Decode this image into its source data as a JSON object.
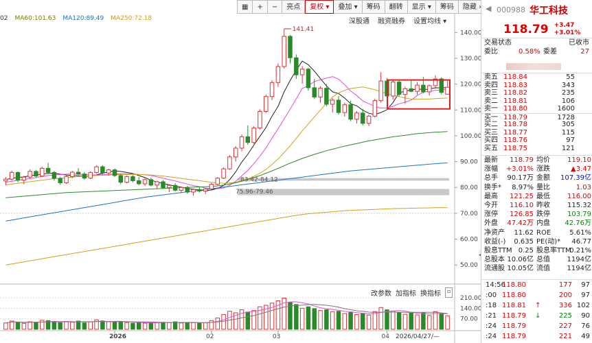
{
  "toolbar": {
    "icons": [
      "calendar-icon",
      "plus-icon",
      "minus-icon"
    ],
    "buttons": [
      "叠加",
      "筹码",
      "翻转",
      "显示",
      "筹码",
      "隐藏"
    ],
    "buttons_full": [
      "复权",
      "叠加",
      "筹码",
      "翻转",
      "显示",
      "筹码",
      "隐藏"
    ],
    "items": [
      "亮点",
      "复权",
      "叠加",
      "筹码",
      "翻转",
      "显示",
      "筹码",
      "隐藏"
    ],
    "active": "复权",
    "more": "»"
  },
  "subtoolbar": {
    "items": [
      "深股通",
      "融资融券",
      "设置均线"
    ]
  },
  "ma_legend": [
    {
      "label": "02",
      "color": "#333333"
    },
    {
      "label": "MA60:101.63",
      "color": "#7a7a00"
    },
    {
      "label": "MA120:89.49",
      "color": "#1a73c8"
    },
    {
      "label": "MA250:72.18",
      "color": "#d4a017"
    }
  ],
  "chart_annotations": {
    "high": "141.41",
    "label_a": "83.42-84.12",
    "label_b": "75.96-79.46"
  },
  "price_axis": [
    "140.00",
    "130.00",
    "120.00",
    "110.00",
    "100.00",
    "90.00",
    "80.00",
    "70.00",
    "60.00",
    "50.00"
  ],
  "volume_axis": [
    "210.00",
    "140.00",
    "70.00"
  ],
  "x_axis": [
    "2026",
    "02",
    "03",
    "04"
  ],
  "cursor_date": "2026/04/27/—",
  "indicator_toolbar": [
    "改参数",
    "加指标",
    "换指标"
  ],
  "chart_data": {
    "type": "candlestick",
    "price_range": [
      45,
      143
    ],
    "volume_range": [
      0,
      215
    ],
    "candles": [
      [
        82.5,
        84.0,
        80.8,
        83.2,
        42
      ],
      [
        83.2,
        86.5,
        82.6,
        85.8,
        55
      ],
      [
        85.8,
        86.2,
        82.0,
        82.8,
        48
      ],
      [
        82.8,
        84.5,
        81.2,
        84.0,
        40
      ],
      [
        84.0,
        87.0,
        83.5,
        86.2,
        50
      ],
      [
        86.2,
        86.8,
        83.8,
        84.4,
        45
      ],
      [
        84.4,
        88.0,
        84.0,
        87.4,
        60
      ],
      [
        87.4,
        89.5,
        85.2,
        85.8,
        58
      ],
      [
        85.8,
        86.4,
        82.6,
        83.5,
        50
      ],
      [
        83.5,
        84.2,
        81.0,
        81.8,
        44
      ],
      [
        81.8,
        84.8,
        81.4,
        84.2,
        52
      ],
      [
        84.2,
        86.4,
        83.6,
        85.9,
        47
      ],
      [
        85.9,
        87.5,
        84.8,
        85.2,
        55
      ],
      [
        85.2,
        86.0,
        83.0,
        83.6,
        42
      ],
      [
        83.6,
        86.2,
        83.2,
        85.8,
        49
      ],
      [
        85.8,
        88.5,
        85.4,
        88.0,
        63
      ],
      [
        88.0,
        88.6,
        85.0,
        85.6,
        56
      ],
      [
        85.6,
        87.2,
        84.6,
        86.8,
        50
      ],
      [
        86.8,
        87.4,
        84.0,
        84.6,
        48
      ],
      [
        84.6,
        85.2,
        81.2,
        82.0,
        52
      ],
      [
        82.0,
        84.6,
        81.6,
        84.2,
        45
      ],
      [
        84.2,
        84.8,
        82.0,
        82.6,
        40
      ],
      [
        82.6,
        84.0,
        80.8,
        81.4,
        44
      ],
      [
        81.4,
        83.5,
        80.6,
        83.0,
        41
      ],
      [
        83.0,
        83.8,
        80.4,
        80.9,
        46
      ],
      [
        80.9,
        82.6,
        79.6,
        82.2,
        43
      ],
      [
        82.2,
        82.8,
        79.4,
        79.9,
        47
      ],
      [
        79.9,
        81.2,
        78.2,
        80.8,
        45
      ],
      [
        80.8,
        81.6,
        78.4,
        78.9,
        50
      ],
      [
        78.9,
        80.4,
        77.8,
        80.0,
        42
      ],
      [
        80.0,
        80.6,
        77.6,
        78.2,
        46
      ],
      [
        78.2,
        79.6,
        76.8,
        79.2,
        44
      ],
      [
        79.2,
        80.2,
        78.0,
        78.6,
        40
      ],
      [
        78.6,
        79.8,
        77.4,
        79.4,
        43
      ],
      [
        79.4,
        81.8,
        79.0,
        81.2,
        58
      ],
      [
        81.2,
        84.0,
        80.8,
        83.6,
        75
      ],
      [
        83.6,
        87.8,
        83.2,
        87.2,
        98
      ],
      [
        87.2,
        92.5,
        86.8,
        91.8,
        120
      ],
      [
        91.8,
        96.0,
        90.0,
        95.2,
        110
      ],
      [
        95.2,
        100.5,
        94.0,
        99.6,
        130
      ],
      [
        99.6,
        104.0,
        96.5,
        97.4,
        115
      ],
      [
        97.4,
        103.8,
        96.8,
        103.0,
        125
      ],
      [
        103.0,
        110.2,
        102.4,
        109.4,
        150
      ],
      [
        109.4,
        116.0,
        108.8,
        115.2,
        160
      ],
      [
        115.2,
        121.5,
        113.8,
        120.6,
        175
      ],
      [
        120.6,
        128.0,
        119.0,
        126.8,
        190
      ],
      [
        126.8,
        141.41,
        126.0,
        138.5,
        208
      ],
      [
        138.5,
        139.0,
        128.0,
        130.2,
        180
      ],
      [
        130.2,
        131.5,
        122.0,
        123.6,
        165
      ],
      [
        123.6,
        127.0,
        120.2,
        125.8,
        140
      ],
      [
        125.8,
        126.4,
        117.5,
        118.6,
        150
      ],
      [
        118.6,
        122.0,
        114.2,
        115.0,
        138
      ],
      [
        115.0,
        119.2,
        112.8,
        118.4,
        125
      ],
      [
        118.4,
        120.0,
        111.4,
        112.2,
        130
      ],
      [
        112.2,
        114.6,
        109.0,
        113.8,
        118
      ],
      [
        113.8,
        115.4,
        108.2,
        109.0,
        120
      ],
      [
        109.0,
        112.8,
        107.4,
        112.0,
        105
      ],
      [
        112.0,
        113.6,
        105.6,
        106.4,
        112
      ],
      [
        106.4,
        109.6,
        104.8,
        108.8,
        98
      ],
      [
        108.8,
        110.4,
        104.0,
        104.8,
        104
      ],
      [
        104.8,
        108.2,
        103.8,
        107.6,
        95
      ],
      [
        107.6,
        114.4,
        107.0,
        113.6,
        118
      ],
      [
        113.6,
        124.6,
        112.8,
        121.2,
        145
      ],
      [
        121.2,
        122.4,
        114.6,
        115.4,
        130
      ],
      [
        115.4,
        121.6,
        114.0,
        120.8,
        122
      ],
      [
        120.8,
        121.8,
        115.2,
        116.0,
        110
      ],
      [
        116.0,
        119.0,
        112.4,
        118.2,
        100
      ],
      [
        118.2,
        121.4,
        116.8,
        117.2,
        108
      ],
      [
        117.2,
        120.8,
        115.8,
        119.6,
        96
      ],
      [
        119.6,
        122.8,
        116.4,
        117.0,
        112
      ],
      [
        117.0,
        119.8,
        115.6,
        119.4,
        92
      ],
      [
        119.4,
        123.4,
        118.2,
        122.0,
        118
      ],
      [
        122.0,
        122.6,
        116.0,
        116.8,
        105
      ],
      [
        116.1,
        121.25,
        116.0,
        118.79,
        90
      ]
    ],
    "ma": {
      "ma5": [
        83,
        83.6,
        83.8,
        84.1,
        84.5,
        84.8,
        85.2,
        85.4,
        85.5,
        85.1,
        84.8,
        84.6,
        84.5,
        84.4,
        84.3,
        84.9,
        85.5,
        86.0,
        86.4,
        86.2,
        85.8,
        85.4,
        84.6,
        83.8,
        82.8,
        82.1,
        81.5,
        81.0,
        80.5,
        80.1,
        79.6,
        79.3,
        79.0,
        78.8,
        79.0,
        79.6,
        80.8,
        83.0,
        86.0,
        89.8,
        92.8,
        96.4,
        99.8,
        103.2,
        107.6,
        111.4,
        117.0,
        121.4,
        125.4,
        128.9,
        127.5,
        125.0,
        122.1,
        119.3,
        117.0,
        116.3,
        114.6,
        112.4,
        111.6,
        109.9,
        108.7,
        108.2,
        109.0,
        110.1,
        112.9,
        116.6,
        117.3,
        117.7,
        118.2,
        117.8,
        118.1,
        118.6,
        118.5,
        118.7
      ],
      "ma10": [
        82,
        82.4,
        82.8,
        83.1,
        83.4,
        83.8,
        84.2,
        84.6,
        84.8,
        85.0,
        85.1,
        85.2,
        85.1,
        85.0,
        84.9,
        84.8,
        84.9,
        85.0,
        85.2,
        85.3,
        85.3,
        85.2,
        85.0,
        84.9,
        84.6,
        84.1,
        83.6,
        83.0,
        82.5,
        81.9,
        81.3,
        80.7,
        80.3,
        79.8,
        79.6,
        79.5,
        79.8,
        80.8,
        82.4,
        84.5,
        86.6,
        89.2,
        92.1,
        95.3,
        99.1,
        102.7,
        106.5,
        110.3,
        114.3,
        118.3,
        119.4,
        121.0,
        121.7,
        122.3,
        122.9,
        121.9,
        119.8,
        117.3,
        115.6,
        113.5,
        112.4,
        111.4,
        110.7,
        110.8,
        111.4,
        112.4,
        113.0,
        113.8,
        115.6,
        116.9,
        117.2,
        117.6,
        117.7,
        118.0
      ],
      "ma20": [
        81,
        81.3,
        81.6,
        81.9,
        82.2,
        82.5,
        82.8,
        83.1,
        83.4,
        83.6,
        83.8,
        84.0,
        84.2,
        84.4,
        84.5,
        84.6,
        84.7,
        84.8,
        84.9,
        85.0,
        85.0,
        85.0,
        85.0,
        84.9,
        84.8,
        84.6,
        84.4,
        84.1,
        83.8,
        83.5,
        83.2,
        82.9,
        82.6,
        82.3,
        82.0,
        81.8,
        81.6,
        81.7,
        82.0,
        82.6,
        83.3,
        84.3,
        85.5,
        87.0,
        88.9,
        91.0,
        93.5,
        96.1,
        99.0,
        101.9,
        104.6,
        107.3,
        110.0,
        112.6,
        115.0,
        116.6,
        117.6,
        118.3,
        118.6,
        118.9,
        118.4,
        117.8,
        117.0,
        116.3,
        115.7,
        115.2,
        114.6,
        114.2,
        114.1,
        114.2,
        114.2,
        114.4,
        114.5,
        114.6
      ],
      "ma60": [
        76,
        76.2,
        76.4,
        76.6,
        76.8,
        77.0,
        77.2,
        77.4,
        77.6,
        77.8,
        78.0,
        78.1,
        78.2,
        78.3,
        78.4,
        78.5,
        78.6,
        78.7,
        78.8,
        78.9,
        79.0,
        79.1,
        79.2,
        79.3,
        79.4,
        79.5,
        79.6,
        79.7,
        79.8,
        79.9,
        80.0,
        80.1,
        80.2,
        80.3,
        80.4,
        80.6,
        80.9,
        81.3,
        81.8,
        82.4,
        83.1,
        83.8,
        84.6,
        85.5,
        86.4,
        87.4,
        88.4,
        89.4,
        90.3,
        91.2,
        92.0,
        92.8,
        93.5,
        94.2,
        94.8,
        95.4,
        96.0,
        96.5,
        97.0,
        97.5,
        98.0,
        98.4,
        98.8,
        99.2,
        99.6,
        99.9,
        100.2,
        100.5,
        100.8,
        101.0,
        101.2,
        101.4,
        101.5,
        101.63
      ],
      "ma120": [
        67,
        67.4,
        67.8,
        68.2,
        68.6,
        69.0,
        69.4,
        69.8,
        70.2,
        70.6,
        71.0,
        71.4,
        71.8,
        72.2,
        72.6,
        73.0,
        73.4,
        73.8,
        74.2,
        74.6,
        75.0,
        75.4,
        75.8,
        76.2,
        76.5,
        76.8,
        77.1,
        77.4,
        77.7,
        78.0,
        78.3,
        78.6,
        78.9,
        79.2,
        79.5,
        79.8,
        80.1,
        80.4,
        80.7,
        81.0,
        81.3,
        81.6,
        81.9,
        82.2,
        82.5,
        82.8,
        83.1,
        83.4,
        83.7,
        84.0,
        84.3,
        84.6,
        84.9,
        85.2,
        85.5,
        85.8,
        86.1,
        86.4,
        86.6,
        86.8,
        87.0,
        87.2,
        87.4,
        87.6,
        87.8,
        88.0,
        88.2,
        88.4,
        88.6,
        88.8,
        89.0,
        89.2,
        89.35,
        89.49
      ],
      "ma250": [
        50,
        50.4,
        50.8,
        51.2,
        51.6,
        52.0,
        52.4,
        52.8,
        53.2,
        53.6,
        54.0,
        54.4,
        54.8,
        55.2,
        55.6,
        56.0,
        56.4,
        56.8,
        57.2,
        57.6,
        58.0,
        58.4,
        58.8,
        59.2,
        59.6,
        60.0,
        60.4,
        60.8,
        61.2,
        61.6,
        62.0,
        62.4,
        62.8,
        63.2,
        63.6,
        64.0,
        64.4,
        64.8,
        65.2,
        65.6,
        66.0,
        66.4,
        66.8,
        67.2,
        67.6,
        68.0,
        68.4,
        68.8,
        69.2,
        69.5,
        69.8,
        70.0,
        70.2,
        70.4,
        70.6,
        70.8,
        71.0,
        71.1,
        71.2,
        71.3,
        71.4,
        71.5,
        71.6,
        71.7,
        71.8,
        71.85,
        71.9,
        71.95,
        72.0,
        72.05,
        72.1,
        72.13,
        72.16,
        72.18
      ]
    }
  },
  "quote": {
    "code": "000988",
    "name": "华工科技",
    "price": "118.79",
    "change": "+3.47",
    "change_pct": "+3.01%",
    "status_label": "交易状态",
    "status_value": "已收市",
    "ratio_label": "委比",
    "ratio_value": "0.58%",
    "diff_label": "委差",
    "diff_value": "27"
  },
  "order_book": [
    {
      "label": "卖五",
      "price": "118.84",
      "vol": "55",
      "side": "ask"
    },
    {
      "label": "卖四",
      "price": "118.83",
      "vol": "343",
      "side": "ask"
    },
    {
      "label": "卖三",
      "price": "118.82",
      "vol": "235",
      "side": "ask"
    },
    {
      "label": "卖二",
      "price": "118.81",
      "vol": "106",
      "side": "ask"
    },
    {
      "label": "卖一",
      "price": "118.80",
      "vol": "1600",
      "side": "ask"
    },
    {
      "label": "买一",
      "price": "118.79",
      "vol": "1728",
      "side": "bid"
    },
    {
      "label": "买二",
      "price": "118.78",
      "vol": "305",
      "side": "bid"
    },
    {
      "label": "买三",
      "price": "118.77",
      "vol": "115",
      "side": "bid"
    },
    {
      "label": "买四",
      "price": "118.76",
      "vol": "97",
      "side": "bid"
    },
    {
      "label": "买五",
      "price": "118.75",
      "vol": "121",
      "side": "bid"
    }
  ],
  "stats": [
    {
      "l1": "最新",
      "v1": "118.79",
      "c1": "red",
      "l2": "均价",
      "v2": "119.10",
      "c2": "red"
    },
    {
      "l1": "涨幅",
      "v1": "+3.01%",
      "c1": "red",
      "l2": "涨跌",
      "v2": "▲3.47",
      "c2": "red"
    },
    {
      "l1": "总手",
      "v1": "90.17万",
      "c1": "",
      "l2": "金额",
      "v2": "107.39亿",
      "c2": "blue"
    },
    {
      "l1": "换手*",
      "v1": "8.97%",
      "c1": "",
      "l2": "量比",
      "v2": "1.03",
      "c2": "red"
    },
    {
      "l1": "最高",
      "v1": "121.25",
      "c1": "red",
      "l2": "最低",
      "v2": "116.00",
      "c2": "red"
    },
    {
      "l1": "今开",
      "v1": "116.10",
      "c1": "red",
      "l2": "昨收",
      "v2": "115.32",
      "c2": ""
    },
    {
      "l1": "涨停",
      "v1": "126.85",
      "c1": "red",
      "l2": "跌停",
      "v2": "103.79",
      "c2": "green"
    },
    {
      "l1": "外盘",
      "v1": "47.42万",
      "c1": "red",
      "l2": "内盘",
      "v2": "42.76万",
      "c2": "green"
    },
    {
      "l1": "净资产",
      "v1": "11.62",
      "c1": "",
      "l2": "ROE",
      "v2": "5.61%",
      "c2": ""
    },
    {
      "l1": "收益(-)",
      "v1": "0.635",
      "c1": "",
      "l2": "PE(动)*",
      "v2": "46.77",
      "c2": ""
    },
    {
      "l1": "股息TTM",
      "v1": "0.25",
      "c1": "",
      "l2": "股息率TTM",
      "v2": "0.21%",
      "c2": ""
    },
    {
      "l1": "总股本",
      "v1": "10.06亿",
      "c1": "",
      "l2": "总值",
      "v2": "1194亿",
      "c2": ""
    },
    {
      "l1": "流通股",
      "v1": "10.05亿",
      "c1": "",
      "l2": "流值",
      "v2": "1194亿",
      "c2": ""
    }
  ],
  "ticks": [
    {
      "time": "14:56",
      "price": "118.80",
      "arrow": "",
      "vol": "177",
      "n": "97",
      "color": "red"
    },
    {
      "time": ":00",
      "price": "118.80",
      "arrow": "",
      "vol": "200",
      "n": "97",
      "color": "red"
    },
    {
      "time": ":18",
      "price": "118.81",
      "arrow": "↑",
      "vol": "336",
      "n": "102",
      "color": "red"
    },
    {
      "time": ":21",
      "price": "118.79",
      "arrow": "↓",
      "vol": "225",
      "n": "90",
      "color": "green"
    },
    {
      "time": ":24",
      "price": "118.79",
      "arrow": "",
      "vol": "227",
      "n": "76",
      "color": "red"
    },
    {
      "time": ":24",
      "price": "118.79",
      "arrow": "",
      "vol": "221",
      "n": "49",
      "color": "red"
    }
  ]
}
